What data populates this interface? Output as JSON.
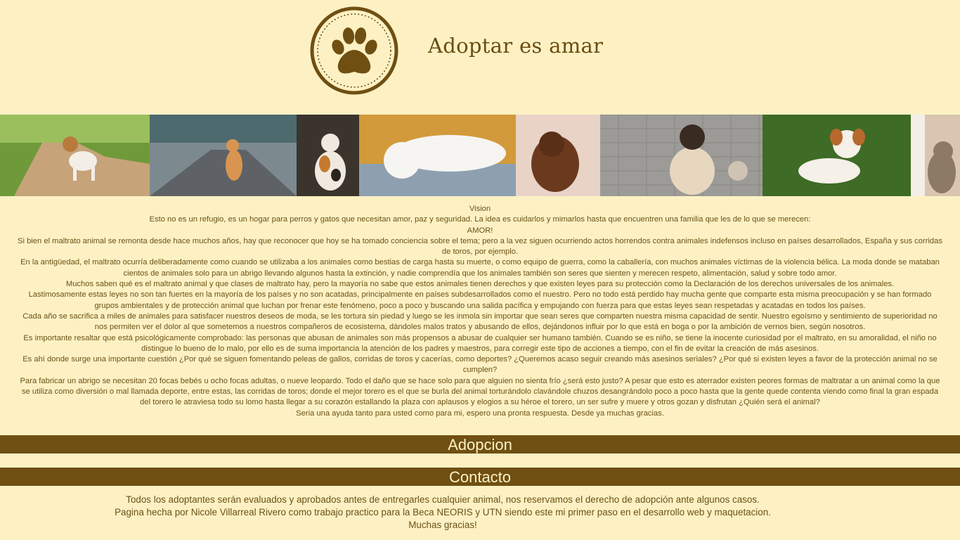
{
  "header": {
    "logo_icon": "paw-print-icon",
    "title": "Adoptar es amar",
    "colors": {
      "brand": "#6f4f12",
      "background": "#fdf1c4",
      "text": "#6b5216"
    }
  },
  "banner": {
    "photos": [
      "dog-on-path-photo",
      "orange-cat-walking-photo",
      "calico-cat-sitting-photo",
      "white-cat-on-blanket-photo",
      "dachshund-puppy-photo",
      "siamese-cat-photo",
      "puppy-on-grass-photo",
      "tabby-cat-yawning-photo"
    ]
  },
  "content": {
    "paragraphs": [
      "Vision",
      "Esto no es un refugio, es un hogar para perros y gatos que necesitan amor, paz y seguridad. La idea es cuidarlos y mimarlos hasta que encuentren una familia que les de lo que se merecen:",
      "AMOR!",
      "Si bien el maltrato animal se remonta desde hace muchos años, hay que reconocer que hoy se ha tomado conciencia sobre el tema; pero a la vez siguen ocurriendo actos horrendos contra animales indefensos incluso en países desarrollados, España y sus corridas de toros, por ejemplo.",
      "En la antigüedad, el maltrato ocurría deliberadamente como cuando se utilizaba a los animales como bestias de carga hasta su muerte, o como equipo de guerra, como la caballería, con muchos animales víctimas de la violencia bélica. La moda donde se mataban cientos de animales solo para un abrigo llevando algunos hasta la extinción, y nadie comprendía que los animales también son seres que sienten y merecen respeto, alimentación, salud y sobre todo amor.",
      "Muchos saben qué es el maltrato animal y que clases de maltrato hay, pero la mayoría no sabe que estos animales tienen derechos y que existen leyes para su protección como la Declaración de los derechos universales de los animales.",
      "Lastimosamente estas leyes no son tan fuertes en la mayoría de los países y no son acatadas, principalmente en países subdesarrollados como el nuestro. Pero no todo está perdido hay mucha gente que comparte esta misma preocupación y se han formado grupos ambientales y de protección animal que luchan por frenar este fenómeno, poco a poco y buscando una salida pacífica y empujando con fuerza para que estas leyes sean respetadas y acatadas en todos los países.",
      "Cada año se sacrifica a miles de animales para satisfacer nuestros deseos de moda, se les tortura sin piedad y luego se les inmola sin importar que sean seres que comparten nuestra misma capacidad de sentir. Nuestro egoísmo y sentimiento de superioridad no nos permiten ver el dolor al que sometemos a nuestros compañeros de ecosistema, dándoles malos tratos y abusando de ellos, dejándonos influir por lo que está en boga o por la ambición de vernos bien, según nosotros.",
      "Es importante resaltar que está psicológicamente comprobado: las personas que abusan de animales son más propensos a abusar de cualquier ser humano también. Cuando se es niño, se tiene la inocente curiosidad por el maltrato, en su amoralidad, el niño no distingue lo bueno de lo malo, por ello es de suma importancia la atención de los padres y maestros, para corregir este tipo de acciones a tiempo, con el fin de evitar la creación de más asesinos.",
      "Es ahí donde surge una importante cuestión ¿Por qué se siguen fomentando peleas de gallos, corridas de toros y cacerías, como deportes? ¿Queremos acaso seguir creando más asesinos seriales? ¿Por qué si existen leyes a favor de la protección animal no se cumplen?",
      "Para fabricar un abrigo se necesitan 20 focas bebés u ocho focas adultas, o nueve leopardo. Todo el daño que se hace solo para que alguien no sienta frío ¿será esto justo? A pesar que esto es aterrador existen peores formas de maltratar a un animal como la que se utiliza como diversión o mal llamada deporte, entre estas, las corridas de toros; donde el mejor torero es el que se burla del animal torturándolo clavándole chuzos desangrándolo poco a poco hasta que la gente quede contenta viendo como final la gran espada del torero le atraviesa todo su lomo hasta llegar a su corazón estallando la plaza con aplausos y elogios a su héroe el torero, un ser sufre y muere y otros gozan y disfrutan ¿Quién será el animal?",
      "Seria una ayuda tanto para usted como para mi, espero una pronta respuesta. Desde ya muchas gracias."
    ]
  },
  "sections": {
    "adopcion": "Adopcion",
    "contacto": "Contacto"
  },
  "footer": {
    "lines": [
      "Todos los adoptantes serán evaluados y aprobados antes de entregarles cualquier animal, nos reservamos el derecho de adopción ante algunos casos.",
      "Pagina hecha por Nicole Villarreal Rivero como trabajo practico para la Beca NEORIS y UTN siendo este mi primer paso en el desarrollo web y maquetacion.",
      "Muchas gracias!"
    ]
  }
}
